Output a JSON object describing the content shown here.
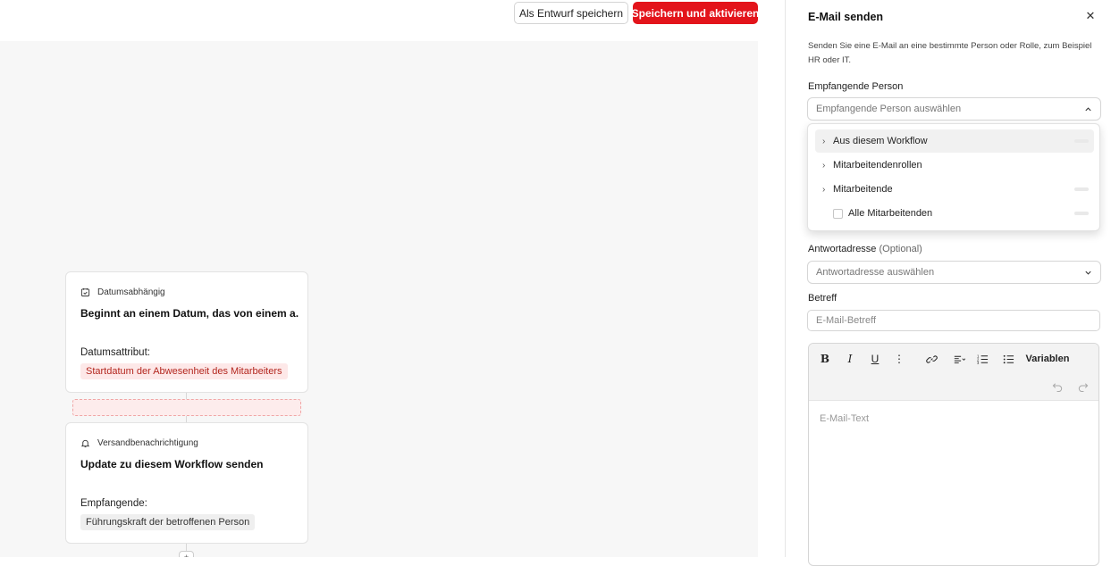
{
  "header": {
    "draft_label": "Als Entwurf speichern",
    "save_label": "Speichern und aktivieren"
  },
  "workflow": {
    "trigger": {
      "type": "Datumsabhängig",
      "title": "Beginnt an einem Datum, das von einem a...",
      "attr_label": "Datumsattribut:",
      "attr_value": "Startdatum der Abwesenheit des Mitarbeiters"
    },
    "action": {
      "type": "Versandbenachrichtigung",
      "title": "Update zu diesem Workflow senden",
      "attr_label": "Empfangende:",
      "attr_value": "Führungskraft der betroffenen Person"
    }
  },
  "panel": {
    "title": "E-Mail senden",
    "description": "Senden Sie eine E-Mail an eine bestimmte Person oder Rolle, zum Beispiel HR oder IT.",
    "recipient": {
      "label": "Empfangende Person",
      "placeholder": "Empfangende Person auswählen",
      "options": [
        "Aus diesem Workflow",
        "Mitarbeitendenrollen",
        "Mitarbeitende",
        "Alle Mitarbeitenden"
      ]
    },
    "reply": {
      "label": "Antwortadresse",
      "optional": "(Optional)",
      "placeholder": "Antwortadresse auswählen"
    },
    "subject": {
      "label": "Betreff",
      "placeholder": "E-Mail-Betreff"
    },
    "editor": {
      "variables_label": "Variablen",
      "placeholder": "E-Mail-Text"
    }
  },
  "colors": {
    "accent": "#e3141b",
    "tag_red_bg": "#fde8e8",
    "tag_red_text": "#b3261e"
  }
}
